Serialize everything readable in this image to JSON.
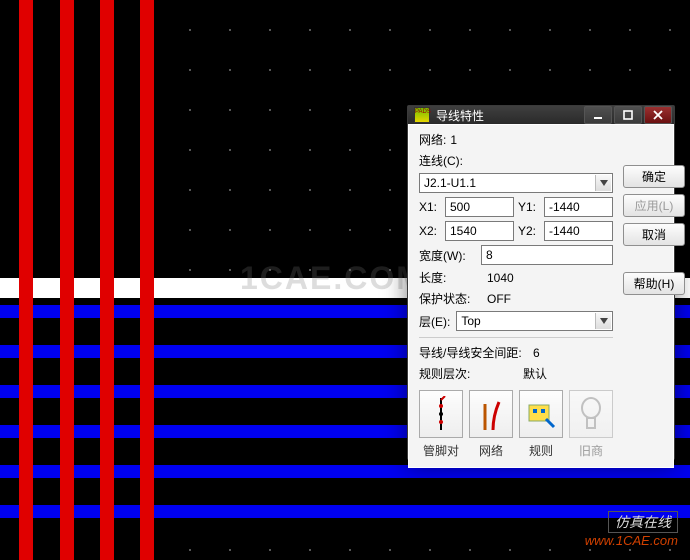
{
  "canvas": {
    "watermark_center": "1CAE.COM",
    "watermark_tag": "仿真在线",
    "watermark_url": "www.1CAE.com"
  },
  "dialog": {
    "title": "导线特性",
    "net_label": "网络:",
    "net_value": "1",
    "conn_label": "连线(C):",
    "conn_value": "J2.1-U1.1",
    "x1_label": "X1:",
    "x1_value": "500",
    "y1_label": "Y1:",
    "y1_value": "-1440",
    "x2_label": "X2:",
    "x2_value": "1540",
    "y2_label": "Y2:",
    "y2_value": "-1440",
    "width_label": "宽度(W):",
    "width_value": "8",
    "length_label": "长度:",
    "length_value": "1040",
    "prot_label": "保护状态:",
    "prot_value": "OFF",
    "layer_label": "层(E):",
    "layer_value": "Top",
    "clearance_label": "导线/导线安全间距:",
    "clearance_value": "6",
    "rule_layer_label": "规则层次:",
    "rule_layer_value": "默认",
    "iconbtns": {
      "pinpair_caption": "管脚对",
      "net_caption": "网络",
      "rule_caption": "规则",
      "reason_caption": "旧商"
    },
    "buttons": {
      "ok": "确定",
      "apply": "应用(L)",
      "cancel": "取消",
      "help": "帮助(H)"
    }
  }
}
